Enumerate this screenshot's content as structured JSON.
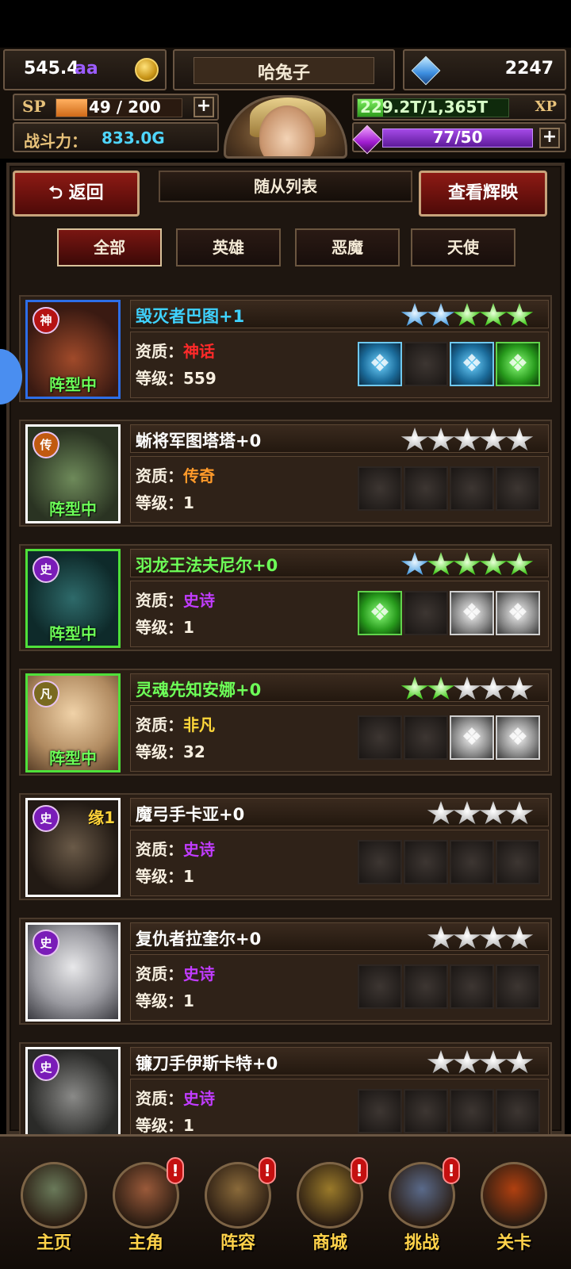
{
  "topbar": {
    "gold": "545.4",
    "gold_suffix": "aa",
    "player_name": "哈兔子",
    "gems": "2247",
    "sp_label": "SP",
    "sp_value": "49 / 200",
    "sp_progress": 0.245,
    "power_label": "战斗力：",
    "power_value": "833.0G",
    "xp_value": "229.2T/1,365T",
    "xp_label": "XP",
    "xp_progress": 0.168,
    "energy_value": "77/50",
    "plus": "+"
  },
  "header": {
    "back_label": "返回",
    "title": "随从列表",
    "view_glory_label": "查看辉映"
  },
  "filters": [
    {
      "label": "全部",
      "active": true
    },
    {
      "label": "英雄",
      "active": false
    },
    {
      "label": "恶魔",
      "active": false
    },
    {
      "label": "天使",
      "active": false
    }
  ],
  "labels": {
    "quality": "资质：",
    "level": "等级：",
    "formation": "阵型中"
  },
  "heroes": [
    {
      "name": "毁灭者巴图+1",
      "name_color": "#3fd2ff",
      "badge": "神",
      "badge_color": "#b51313",
      "frame_color": "#2d6ee8",
      "quality": "神话",
      "quality_color": "#ff2a2a",
      "level": "559",
      "in_formation": true,
      "yuan": "",
      "stars": [
        "blue",
        "blue",
        "green",
        "green",
        "green"
      ],
      "slots": [
        "blue",
        "empty",
        "blue",
        "green"
      ]
    },
    {
      "name": "蜥将军图塔塔+0",
      "name_color": "#ffffff",
      "badge": "传",
      "badge_color": "#c05a10",
      "frame_color": "#ffffff",
      "quality": "传奇",
      "quality_color": "#ff9a2a",
      "level": "1",
      "in_formation": true,
      "yuan": "",
      "stars": [
        "silver",
        "silver",
        "silver",
        "silver",
        "silver"
      ],
      "slots": [
        "empty",
        "empty",
        "empty",
        "empty"
      ]
    },
    {
      "name": "羽龙王法夫尼尔+0",
      "name_color": "#6dff58",
      "badge": "史",
      "badge_color": "#7a1cb8",
      "frame_color": "#4ee03a",
      "quality": "史诗",
      "quality_color": "#c13cff",
      "level": "1",
      "in_formation": true,
      "yuan": "",
      "stars": [
        "blue",
        "green",
        "green",
        "green",
        "green"
      ],
      "slots": [
        "green",
        "empty",
        "white",
        "white"
      ]
    },
    {
      "name": "灵魂先知安娜+0",
      "name_color": "#6dff58",
      "badge": "凡",
      "badge_color": "#7a6a20",
      "frame_color": "#4ee03a",
      "quality": "非凡",
      "quality_color": "#ffd83a",
      "level": "32",
      "in_formation": true,
      "yuan": "",
      "stars": [
        "green",
        "green",
        "silver",
        "silver",
        "silver"
      ],
      "slots": [
        "empty",
        "empty",
        "white",
        "white"
      ]
    },
    {
      "name": "魔弓手卡亚+0",
      "name_color": "#ffffff",
      "badge": "史",
      "badge_color": "#7a1cb8",
      "frame_color": "#ffffff",
      "quality": "史诗",
      "quality_color": "#c13cff",
      "level": "1",
      "in_formation": false,
      "yuan": "缘1",
      "stars": [
        "silver",
        "silver",
        "silver",
        "silver"
      ],
      "slots": [
        "empty",
        "empty",
        "empty",
        "empty"
      ]
    },
    {
      "name": "复仇者拉奎尔+0",
      "name_color": "#ffffff",
      "badge": "史",
      "badge_color": "#7a1cb8",
      "frame_color": "#ffffff",
      "quality": "史诗",
      "quality_color": "#c13cff",
      "level": "1",
      "in_formation": false,
      "yuan": "",
      "stars": [
        "silver",
        "silver",
        "silver",
        "silver"
      ],
      "slots": [
        "empty",
        "empty",
        "empty",
        "empty"
      ]
    },
    {
      "name": "镰刀手伊斯卡特+0",
      "name_color": "#ffffff",
      "badge": "史",
      "badge_color": "#7a1cb8",
      "frame_color": "#ffffff",
      "quality": "史诗",
      "quality_color": "#c13cff",
      "level": "1",
      "in_formation": false,
      "yuan": "",
      "stars": [
        "silver",
        "silver",
        "silver",
        "silver"
      ],
      "slots": [
        "empty",
        "empty",
        "empty",
        "empty"
      ]
    }
  ],
  "bottom_nav": [
    {
      "label": "主页",
      "alert": false,
      "icon": "castle-icon"
    },
    {
      "label": "主角",
      "alert": true,
      "icon": "hero-portrait-icon"
    },
    {
      "label": "阵容",
      "alert": true,
      "icon": "helmet-icon"
    },
    {
      "label": "商城",
      "alert": true,
      "icon": "treasure-chest-icon"
    },
    {
      "label": "挑战",
      "alert": true,
      "icon": "crossed-swords-icon"
    },
    {
      "label": "关卡",
      "alert": false,
      "icon": "flame-gate-icon"
    }
  ],
  "alert_mark": "!"
}
